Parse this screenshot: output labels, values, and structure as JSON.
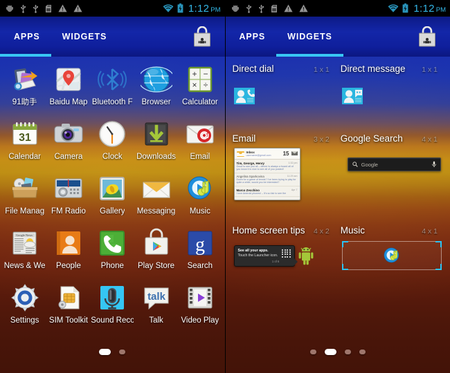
{
  "colors": {
    "accent_cyan": "#33b5e5",
    "tabbar_blue": "#1326a8",
    "wall_top": "#1a33b0",
    "wall_mid": "#b88a10",
    "wall_bottom": "#431308"
  },
  "status_bar": {
    "icons": [
      "android-debug-icon",
      "usb-icon",
      "usb-icon",
      "sd-card-icon",
      "warning-icon",
      "warning-icon"
    ],
    "wifi": "wifi-icon",
    "battery": "battery-charging-icon",
    "time": "1:12",
    "ampm": "PM"
  },
  "left_panel": {
    "tabs": [
      {
        "label": "APPS",
        "active": true
      },
      {
        "label": "WIDGETS",
        "active": false
      }
    ],
    "store_button": "play-store-bag-icon",
    "apps": [
      {
        "label": "91助手",
        "icon": "assistant91-icon"
      },
      {
        "label": "Baidu Map",
        "icon": "baidu-map-icon"
      },
      {
        "label": "Bluetooth F",
        "icon": "bluetooth-icon"
      },
      {
        "label": "Browser",
        "icon": "browser-globe-icon"
      },
      {
        "label": "Calculator",
        "icon": "calculator-icon"
      },
      {
        "label": "Calendar",
        "icon": "calendar-icon",
        "badge": "31"
      },
      {
        "label": "Camera",
        "icon": "camera-icon"
      },
      {
        "label": "Clock",
        "icon": "clock-icon"
      },
      {
        "label": "Downloads",
        "icon": "downloads-icon"
      },
      {
        "label": "Email",
        "icon": "email-icon"
      },
      {
        "label": "File Manag",
        "icon": "file-manager-icon"
      },
      {
        "label": "FM Radio",
        "icon": "fm-radio-icon"
      },
      {
        "label": "Gallery",
        "icon": "gallery-icon"
      },
      {
        "label": "Messaging",
        "icon": "messaging-envelope-icon"
      },
      {
        "label": "Music",
        "icon": "music-icon"
      },
      {
        "label": "News & We",
        "icon": "news-weather-icon"
      },
      {
        "label": "People",
        "icon": "people-icon"
      },
      {
        "label": "Phone",
        "icon": "phone-icon"
      },
      {
        "label": "Play Store",
        "icon": "play-store-bag-icon"
      },
      {
        "label": "Search",
        "icon": "google-search-g-icon"
      },
      {
        "label": "Settings",
        "icon": "settings-gear-icon"
      },
      {
        "label": "SIM Toolkit",
        "icon": "sim-toolkit-icon"
      },
      {
        "label": "Sound Reco",
        "icon": "sound-recorder-icon"
      },
      {
        "label": "Talk",
        "icon": "talk-icon",
        "badge": "talk"
      },
      {
        "label": "Video Play",
        "icon": "video-player-icon"
      }
    ],
    "pages": {
      "count": 2,
      "active": 0
    }
  },
  "right_panel": {
    "tabs": [
      {
        "label": "APPS",
        "active": false
      },
      {
        "label": "WIDGETS",
        "active": true
      }
    ],
    "store_button": "play-store-bag-icon",
    "widgets": [
      {
        "name": "Direct dial",
        "size": "1 x 1",
        "icon": "contact-dial-icon"
      },
      {
        "name": "Direct message",
        "size": "1 x 1",
        "icon": "contact-message-icon"
      },
      {
        "name": "Email",
        "size": "3 x 2",
        "icon": "email-widget-preview"
      },
      {
        "name": "Google Search",
        "size": "4 x 1",
        "icon": "google-search-bar-preview"
      },
      {
        "name": "Home screen tips",
        "size": "4 x 2",
        "icon": "home-screen-tips-preview"
      },
      {
        "name": "Music",
        "size": "4 x 1",
        "icon": "music-widget-preview"
      }
    ],
    "email_preview": {
      "folder": "Inbox",
      "account": "username@gmail.com",
      "count": "15",
      "messages": [
        {
          "from": "Tim, George, Henry",
          "time": "1:32 pm",
          "snippet": "Good to see you all – dinner is always a board all of you know it is nice to see all of you posted!",
          "unread": true
        },
        {
          "from": "Angelina Sparkovina",
          "time": "11:29 am",
          "snippet": "Down for a game of tennis? I've been trying to play for quite a while, would you be interested?",
          "unread": false
        },
        {
          "from": "Marco Zecchino",
          "time": "Apr 7",
          "snippet": "I love Android phones! – It's so fair to see the",
          "unread": true
        }
      ]
    },
    "google_search_preview": {
      "placeholder": "Google",
      "search_icon": "magnifier-icon",
      "mic_icon": "microphone-icon"
    },
    "tips_preview": {
      "line1": "See all your apps.",
      "line2": "Touch the Launcher icon.",
      "page": "1 of 6"
    },
    "pages": {
      "count": 4,
      "active": 1
    }
  }
}
